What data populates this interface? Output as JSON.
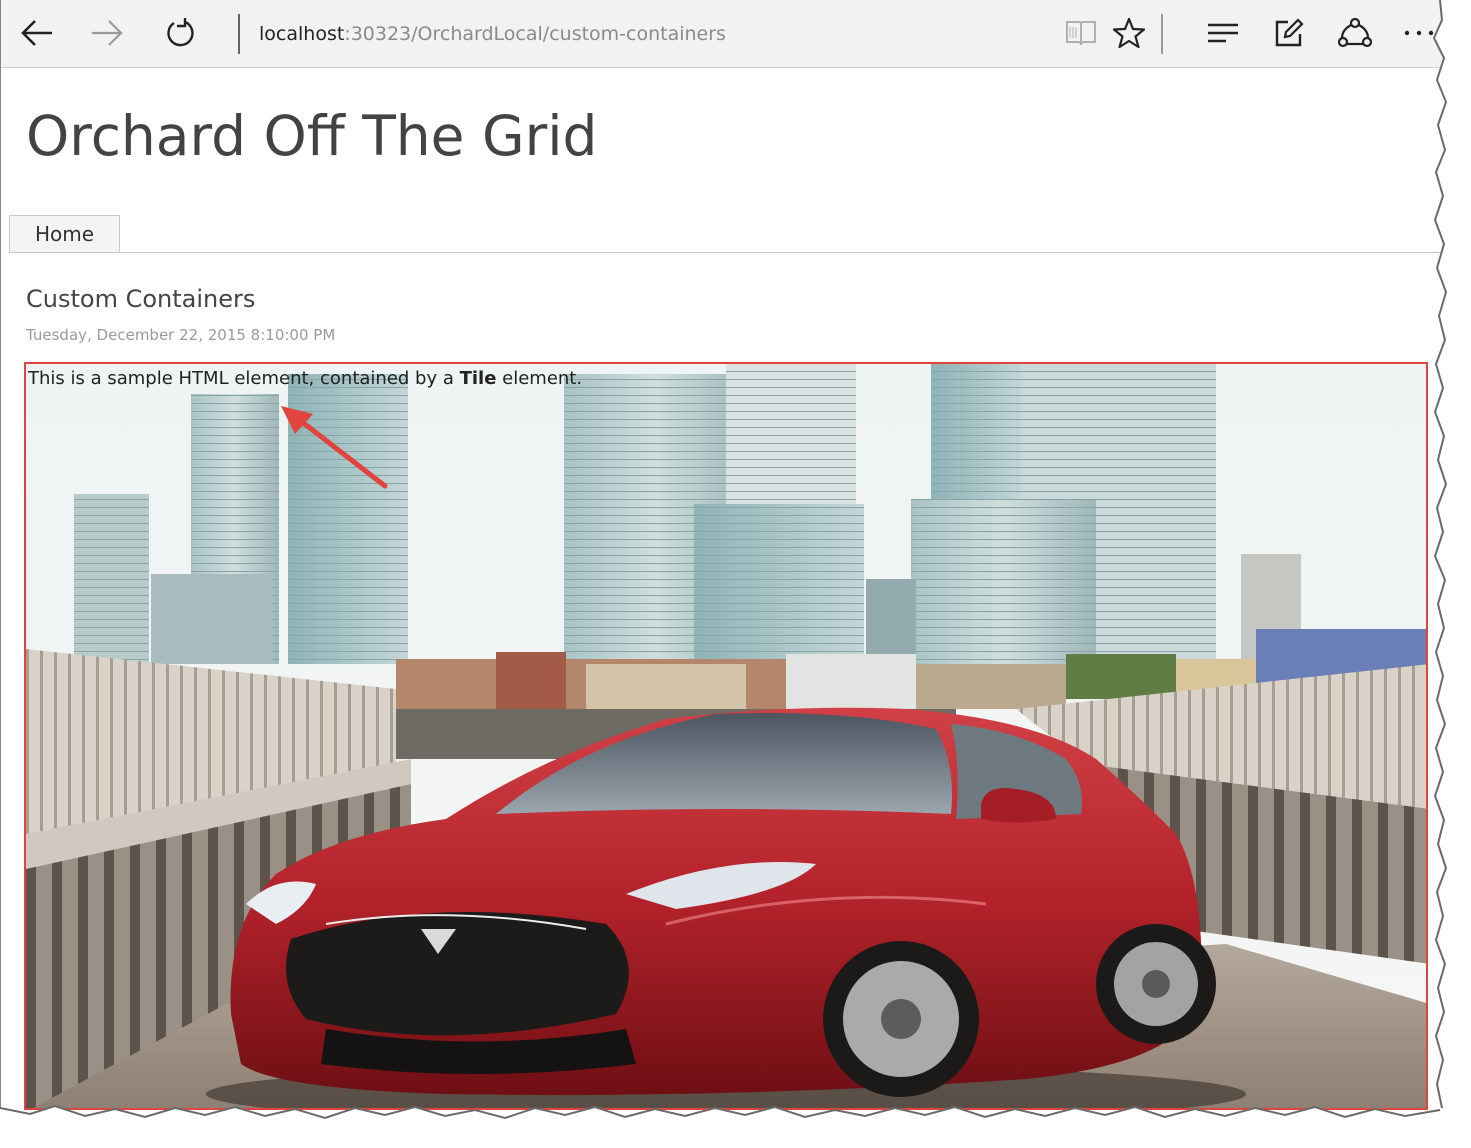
{
  "browser": {
    "address_host": "localhost",
    "address_path": ":30323/OrchardLocal/custom-containers",
    "icons": [
      "back-arrow-icon",
      "forward-arrow-icon",
      "refresh-icon",
      "reading-view-icon",
      "favorite-star-icon",
      "hub-icon",
      "web-note-icon",
      "share-icon",
      "more-icon"
    ]
  },
  "site": {
    "title": "Orchard Off The Grid",
    "nav": [
      {
        "label": "Home"
      }
    ]
  },
  "content": {
    "heading": "Custom Containers",
    "date": "Tuesday, December 22, 2015 8:10:00 PM",
    "tile_text_before": "This is a sample HTML element, contained by a ",
    "tile_text_bold": "Tile",
    "tile_text_after": " element."
  },
  "colors": {
    "highlight_border": "#e0443f",
    "arrow": "#e0443f",
    "car_body": "#b3222a"
  }
}
